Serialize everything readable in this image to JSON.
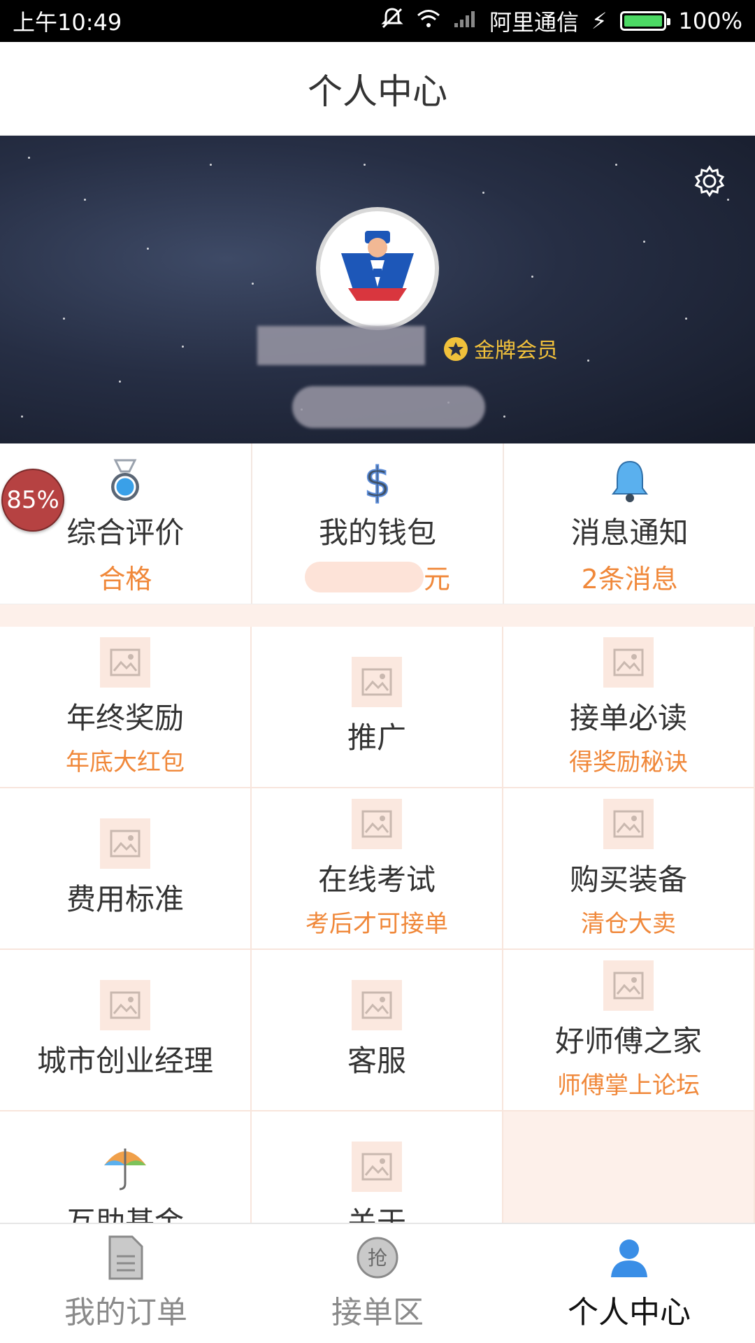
{
  "status_bar": {
    "time": "上午10:49",
    "carrier": "阿里通信",
    "battery": "100%"
  },
  "title": "个人中心",
  "profile": {
    "member_badge": "金牌会员"
  },
  "quick_stats": [
    {
      "label": "综合评价",
      "sub": "合格",
      "icon": "medal-icon"
    },
    {
      "label": "我的钱包",
      "sub": "元",
      "icon": "dollar-icon"
    },
    {
      "label": "消息通知",
      "sub": "2条消息",
      "icon": "bell-icon"
    }
  ],
  "overlay_badge": "85%",
  "menu": [
    {
      "label": "年终奖励",
      "sub": "年底大红包"
    },
    {
      "label": "推广",
      "sub": ""
    },
    {
      "label": "接单必读",
      "sub": "得奖励秘诀"
    },
    {
      "label": "费用标准",
      "sub": ""
    },
    {
      "label": "在线考试",
      "sub": "考后才可接单"
    },
    {
      "label": "购买装备",
      "sub": "清仓大卖"
    },
    {
      "label": "城市创业经理",
      "sub": ""
    },
    {
      "label": "客服",
      "sub": ""
    },
    {
      "label": "好师傅之家",
      "sub": "师傅掌上论坛"
    },
    {
      "label": "互助基金",
      "sub": ""
    },
    {
      "label": "关于",
      "sub": ""
    }
  ],
  "bottom_nav": [
    {
      "label": "我的订单",
      "icon": "document-icon"
    },
    {
      "label": "接单区",
      "icon": "grab-icon",
      "icon_text": "抢"
    },
    {
      "label": "个人中心",
      "icon": "person-icon"
    }
  ],
  "colors": {
    "accent": "#f0883a",
    "member_gold": "#f1c13b",
    "active_nav": "#3a8ee6"
  }
}
